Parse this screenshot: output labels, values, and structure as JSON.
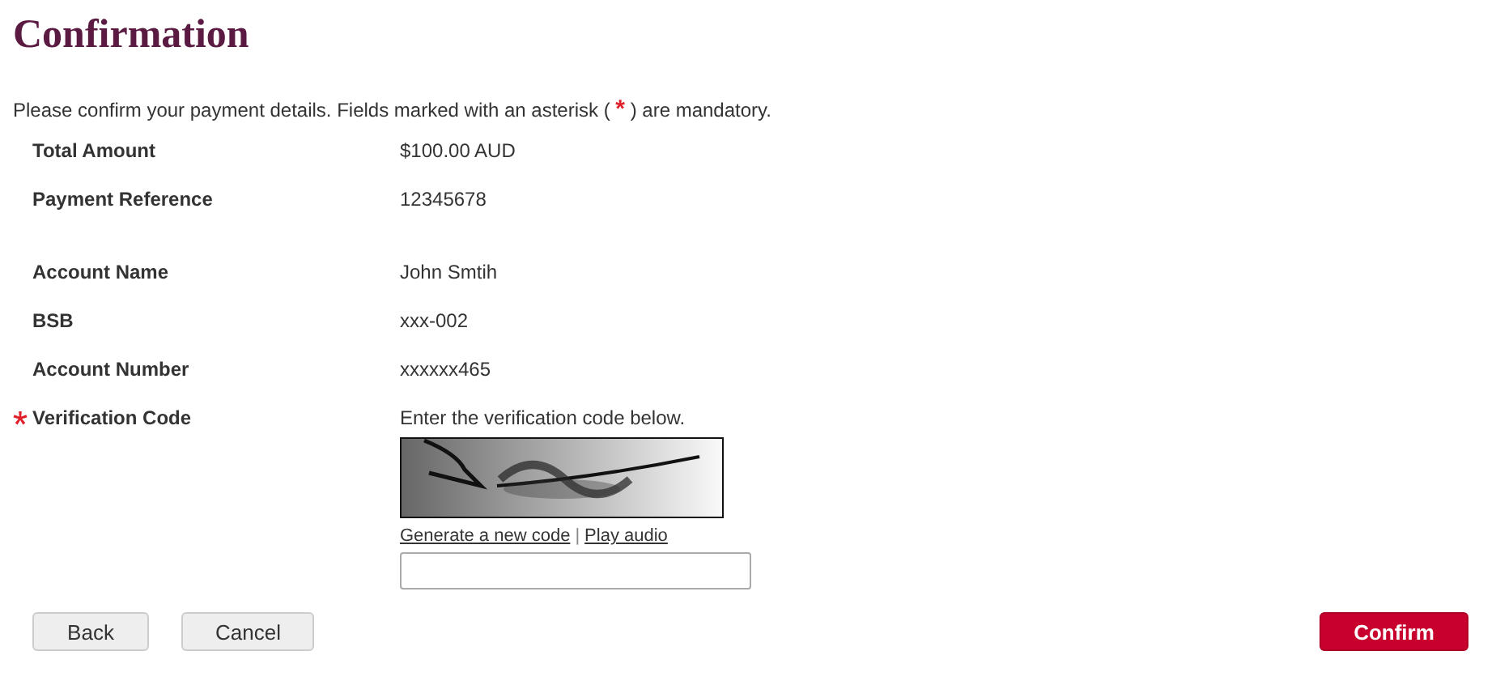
{
  "title": "Confirmation",
  "intro": {
    "before": "Please confirm your payment details. Fields marked with an asterisk (",
    "mark": "*",
    "after": ") are mandatory."
  },
  "sections": [
    {
      "rows": [
        {
          "label": "Total Amount",
          "value": "$100.00 AUD"
        },
        {
          "label": "Payment Reference",
          "value": "12345678"
        }
      ]
    },
    {
      "rows": [
        {
          "label": "Account Name",
          "value": "John Smtih"
        },
        {
          "label": "BSB",
          "value": "xxx-002"
        },
        {
          "label": "Account Number",
          "value": "xxxxxx465"
        }
      ]
    }
  ],
  "verification": {
    "label": "Verification Code",
    "required": true,
    "instruction": "Enter the verification code below.",
    "image": {
      "kind": "picture"
    },
    "links": [
      "Generate a new code",
      "Play audio"
    ],
    "separator": "|"
  },
  "buttons": [
    {
      "label": "Back",
      "kind": "secondary"
    },
    {
      "label": "Cancel",
      "kind": "secondary"
    },
    {
      "label": "Confirm",
      "kind": "primary"
    }
  ]
}
